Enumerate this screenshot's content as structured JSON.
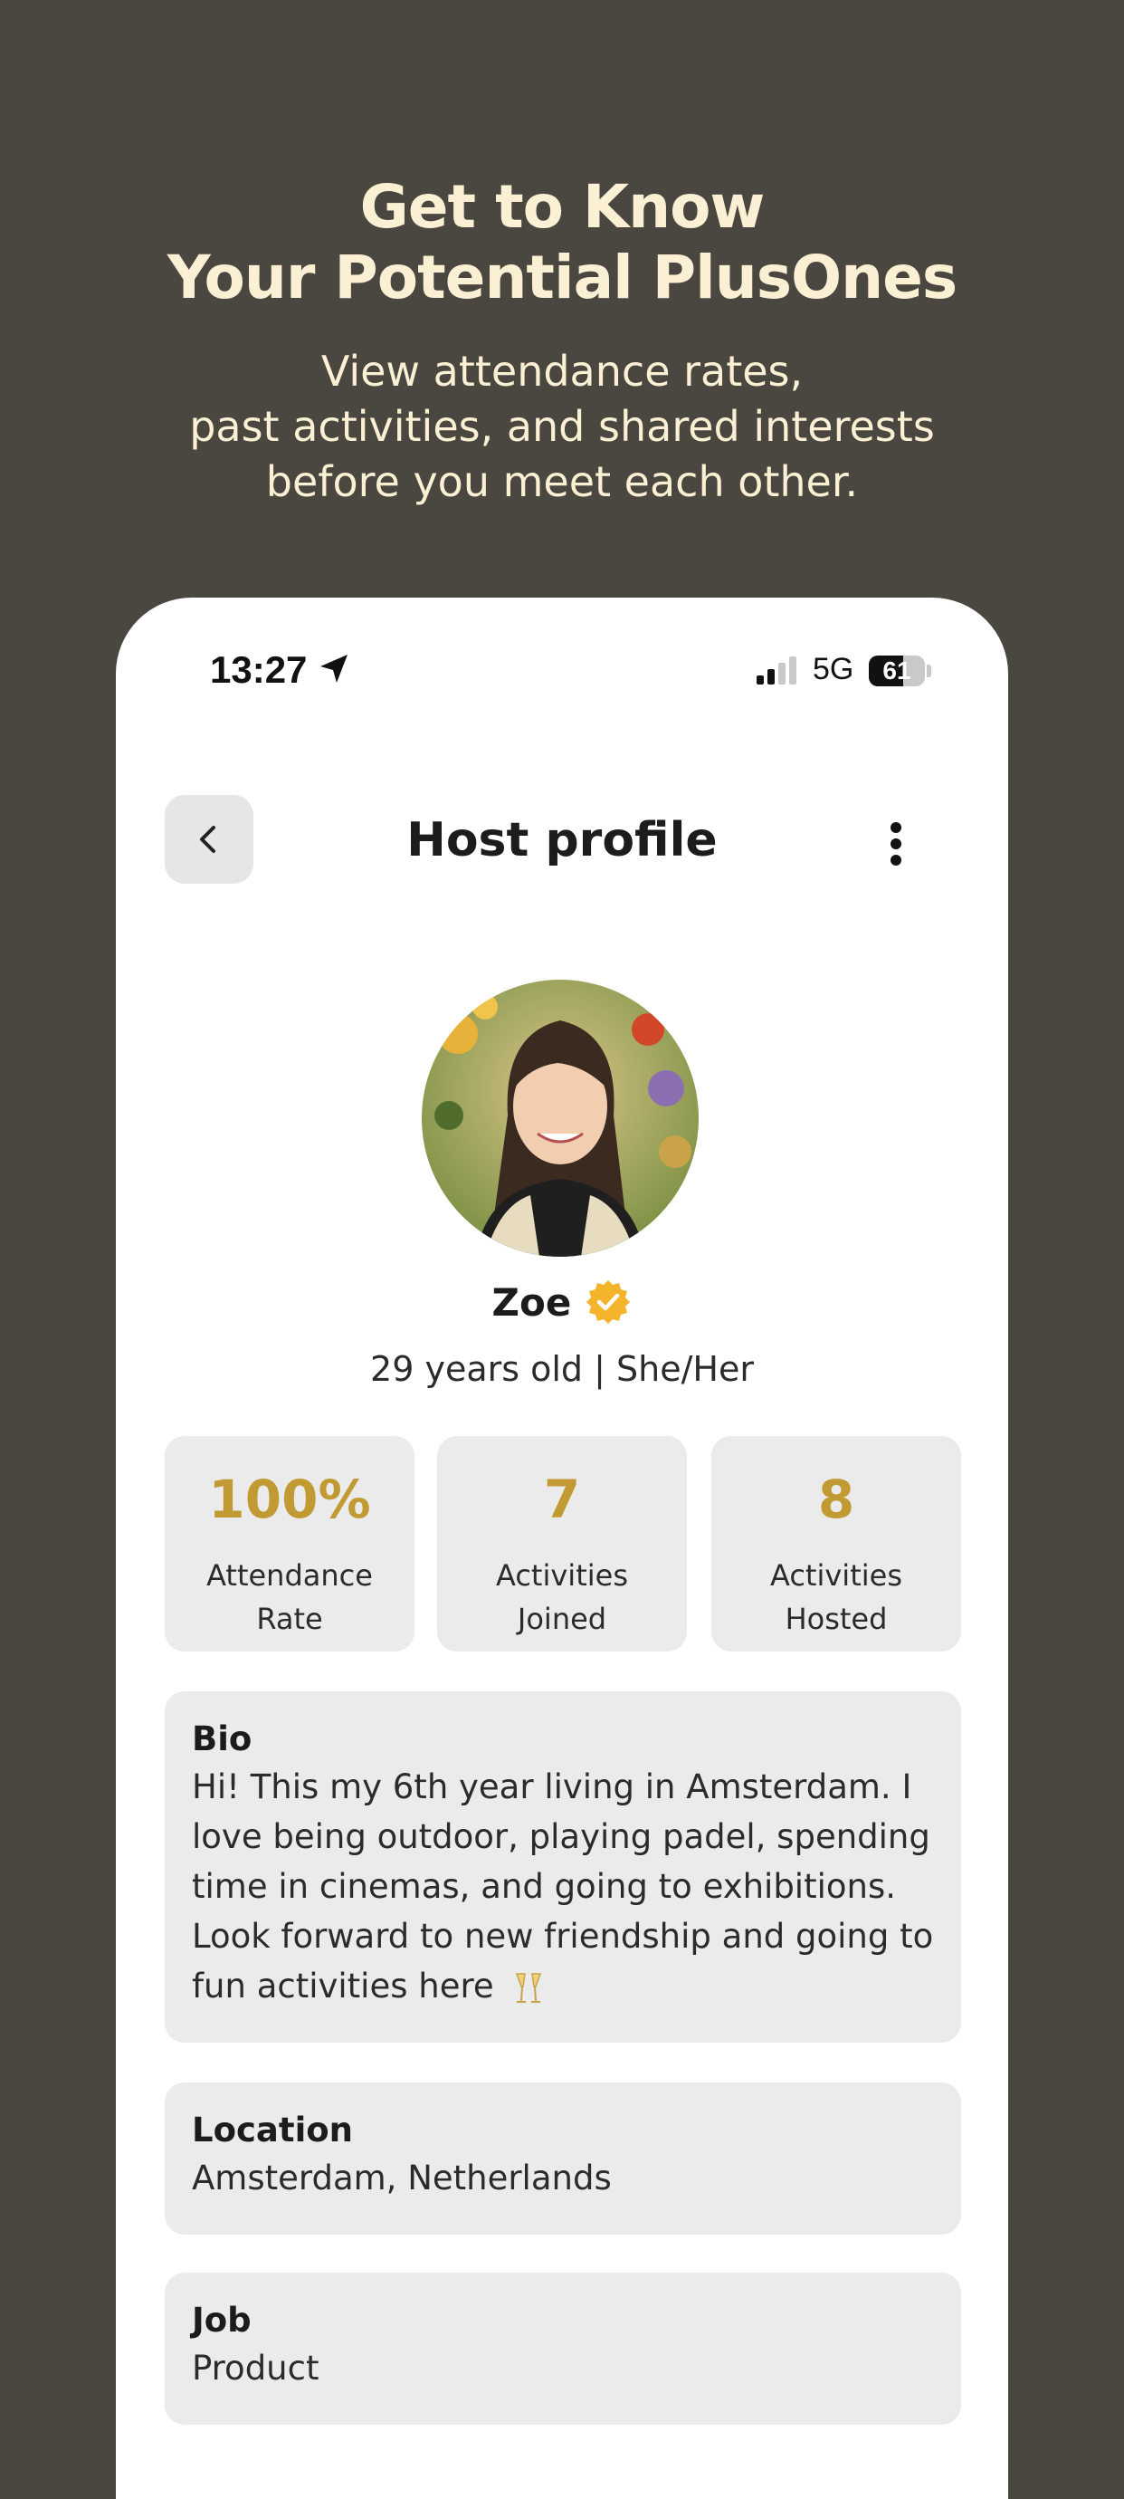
{
  "promo": {
    "headline_line1": "Get to Know",
    "headline_line2": "Your Potential PlusOnes",
    "subline_line1": "View attendance rates,",
    "subline_line2": "past activities, and shared interests",
    "subline_line3": "before you meet each other."
  },
  "status_bar": {
    "time": "13:27",
    "network": "5G",
    "battery": "61"
  },
  "header": {
    "title": "Host profile",
    "back_icon": "chevron-left-icon",
    "more_icon": "more-vertical-icon"
  },
  "profile": {
    "name": "Zoe",
    "verified_icon": "verified-badge-icon",
    "meta": "29 years old |  She/Her"
  },
  "stats": [
    {
      "value": "100%",
      "label_line1": "Attendance",
      "label_line2": "Rate"
    },
    {
      "value": "7",
      "label_line1": "Activities",
      "label_line2": "Joined"
    },
    {
      "value": "8",
      "label_line1": "Activities",
      "label_line2": "Hosted"
    }
  ],
  "bio": {
    "title": "Bio",
    "lines": [
      "Hi! This my 6th year living in Amsterdam. I",
      "love being outdoor, playing padel, spending",
      "time in cinemas, and going to exhibitions.",
      "Look forward to new friendship and going to",
      "fun activities here"
    ]
  },
  "location": {
    "title": "Location",
    "value": "Amsterdam, Netherlands"
  },
  "job": {
    "title": "Job",
    "value": "Product"
  },
  "colors": {
    "background": "#4a4640",
    "headline": "#fbf0d4",
    "accent": "#c29a33",
    "card": "#ebebeb"
  }
}
